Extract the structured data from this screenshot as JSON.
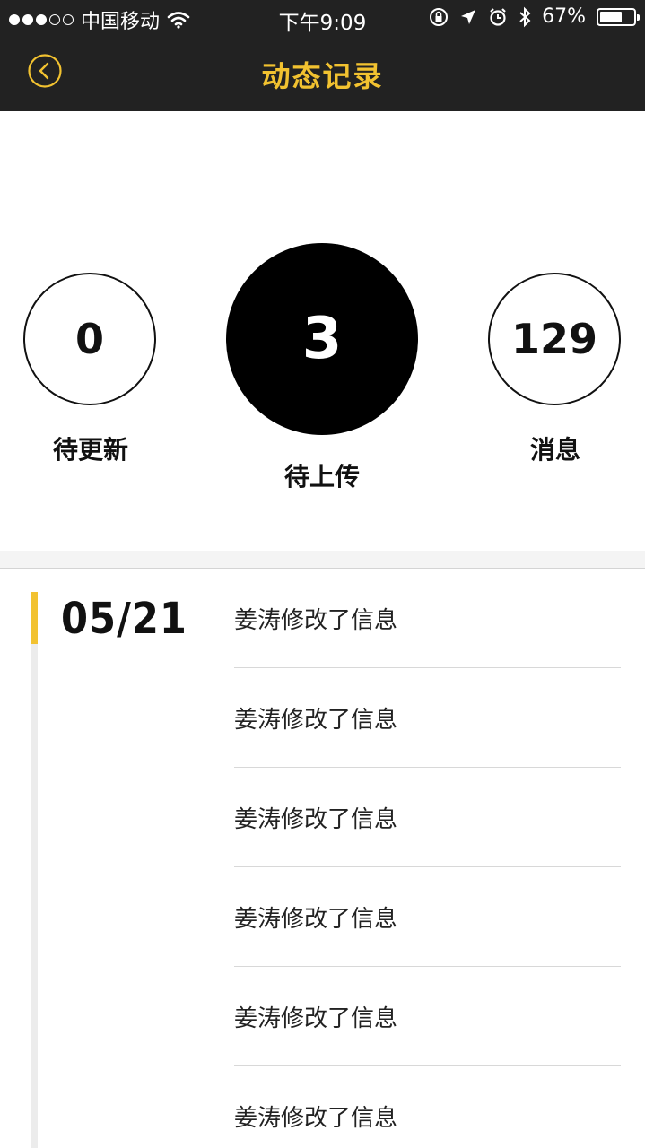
{
  "status_bar": {
    "carrier": "中国移动",
    "time": "下午9:09",
    "battery_text": "67%",
    "battery_level": 0.67,
    "signal_filled": 3,
    "signal_total": 5
  },
  "nav": {
    "title": "动态记录",
    "back_icon": "chevron-left-circle-icon",
    "accent_color": "#f2c230"
  },
  "stats": {
    "pending_update": {
      "value": "0",
      "label": "待更新"
    },
    "pending_upload": {
      "value": "3",
      "label": "待上传"
    },
    "messages": {
      "value": "129",
      "label": "消息"
    }
  },
  "timeline": {
    "date": "05/21",
    "items": [
      {
        "text": "姜涛修改了信息"
      },
      {
        "text": "姜涛修改了信息"
      },
      {
        "text": "姜涛修改了信息"
      },
      {
        "text": "姜涛修改了信息"
      },
      {
        "text": "姜涛修改了信息"
      },
      {
        "text": "姜涛修改了信息"
      }
    ]
  }
}
